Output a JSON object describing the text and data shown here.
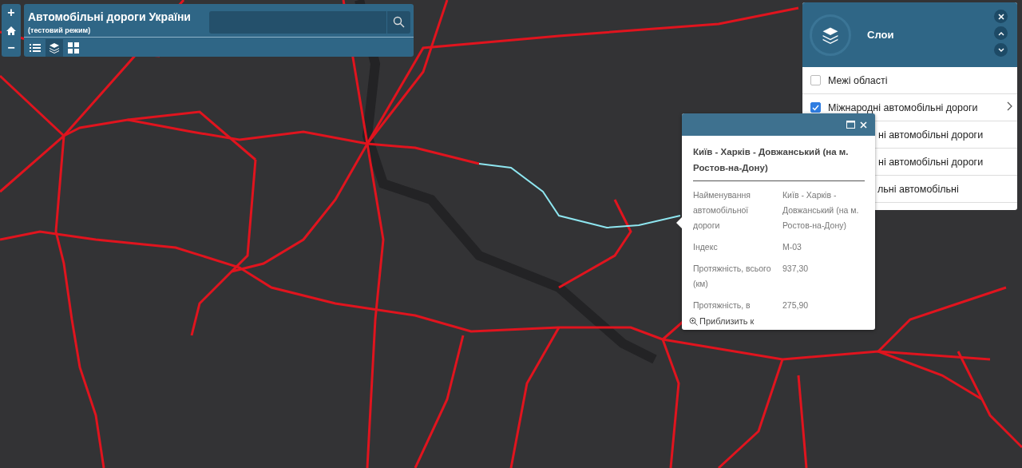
{
  "app": {
    "title": "Автомобільні дороги України",
    "subtitle": "(тестовий режим)"
  },
  "zoom_controls": [
    "+",
    "−"
  ],
  "toolbar": [
    {
      "kind": "list",
      "selected": false
    },
    {
      "kind": "layers",
      "selected": true
    },
    {
      "kind": "grid",
      "selected": false
    }
  ],
  "layers_panel": {
    "title": "Слои",
    "items": [
      {
        "kind": "layer",
        "label": "Межі області",
        "checked": false,
        "expandable": false
      },
      {
        "kind": "layer",
        "label": "Міжнародні автомобільні дороги",
        "checked": true,
        "expandable": true
      },
      {
        "kind": "covered",
        "label": "ні автомобільні дороги"
      },
      {
        "kind": "covered",
        "label": "ні автомобільні дороги"
      },
      {
        "kind": "covered",
        "label": "льні автомобільні"
      }
    ]
  },
  "popup": {
    "title": "Київ - Харків - Довжанський (на м. Ростов-на-Дону)",
    "rows": [
      {
        "name": "Найменування автомобільної дороги",
        "value": "Київ - Харків - Довжанський (на м. Ростов-на-Дону)"
      },
      {
        "name": "Індекс",
        "value": "М-03"
      },
      {
        "name": "Протяжність, всього (км)",
        "value": "937,30"
      },
      {
        "name": "Протяжність, в",
        "value": "275,90"
      }
    ],
    "zoom_link": "Приблизить к"
  }
}
